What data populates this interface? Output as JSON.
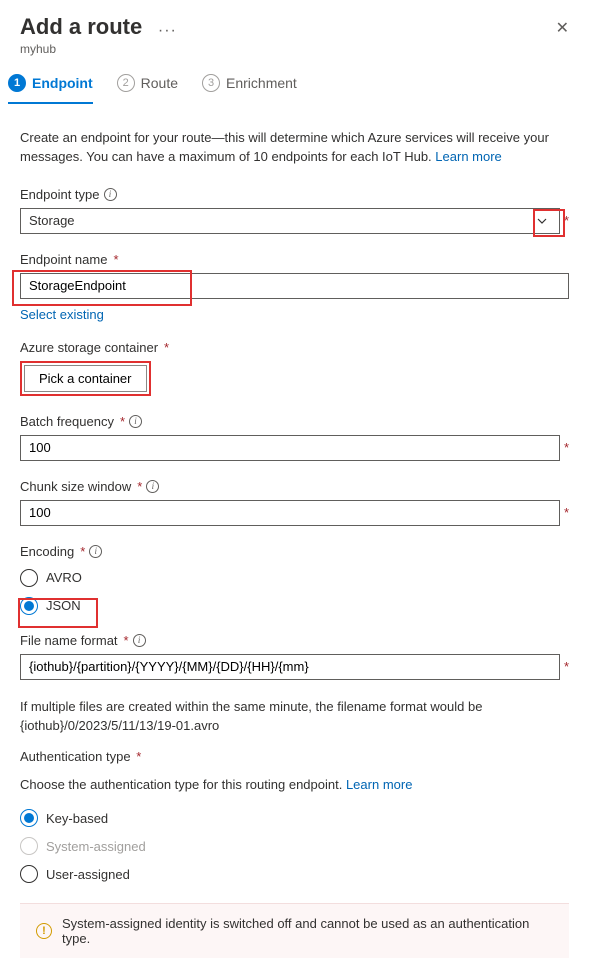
{
  "header": {
    "title": "Add a route",
    "subtitle": "myhub"
  },
  "steps": {
    "s1": "Endpoint",
    "s2": "Route",
    "s3": "Enrichment"
  },
  "intro": {
    "text_a": "Create an endpoint for your route—this will determine which Azure services will receive your messages. You can have a maximum of 10 endpoints for each IoT Hub. ",
    "learn_more": "Learn more"
  },
  "endpoint_type": {
    "label": "Endpoint type",
    "value": "Storage"
  },
  "endpoint_name": {
    "label": "Endpoint name",
    "value": "StorageEndpoint",
    "select_existing": "Select existing"
  },
  "storage_container": {
    "label": "Azure storage container",
    "button": "Pick a container"
  },
  "batch_freq": {
    "label": "Batch frequency",
    "value": "100"
  },
  "chunk_size": {
    "label": "Chunk size window",
    "value": "100"
  },
  "encoding": {
    "label": "Encoding",
    "opt_avro": "AVRO",
    "opt_json": "JSON"
  },
  "file_format": {
    "label": "File name format",
    "value": "{iothub}/{partition}/{YYYY}/{MM}/{DD}/{HH}/{mm}",
    "help": "If multiple files are created within the same minute, the filename format would be {iothub}/0/2023/5/11/13/19-01.avro"
  },
  "auth": {
    "label": "Authentication type",
    "help_a": "Choose the authentication type for this routing endpoint. ",
    "learn_more": "Learn more",
    "opt_key": "Key-based",
    "opt_system": "System-assigned",
    "opt_user": "User-assigned"
  },
  "warning": "System-assigned identity is switched off and cannot be used as an authentication type."
}
